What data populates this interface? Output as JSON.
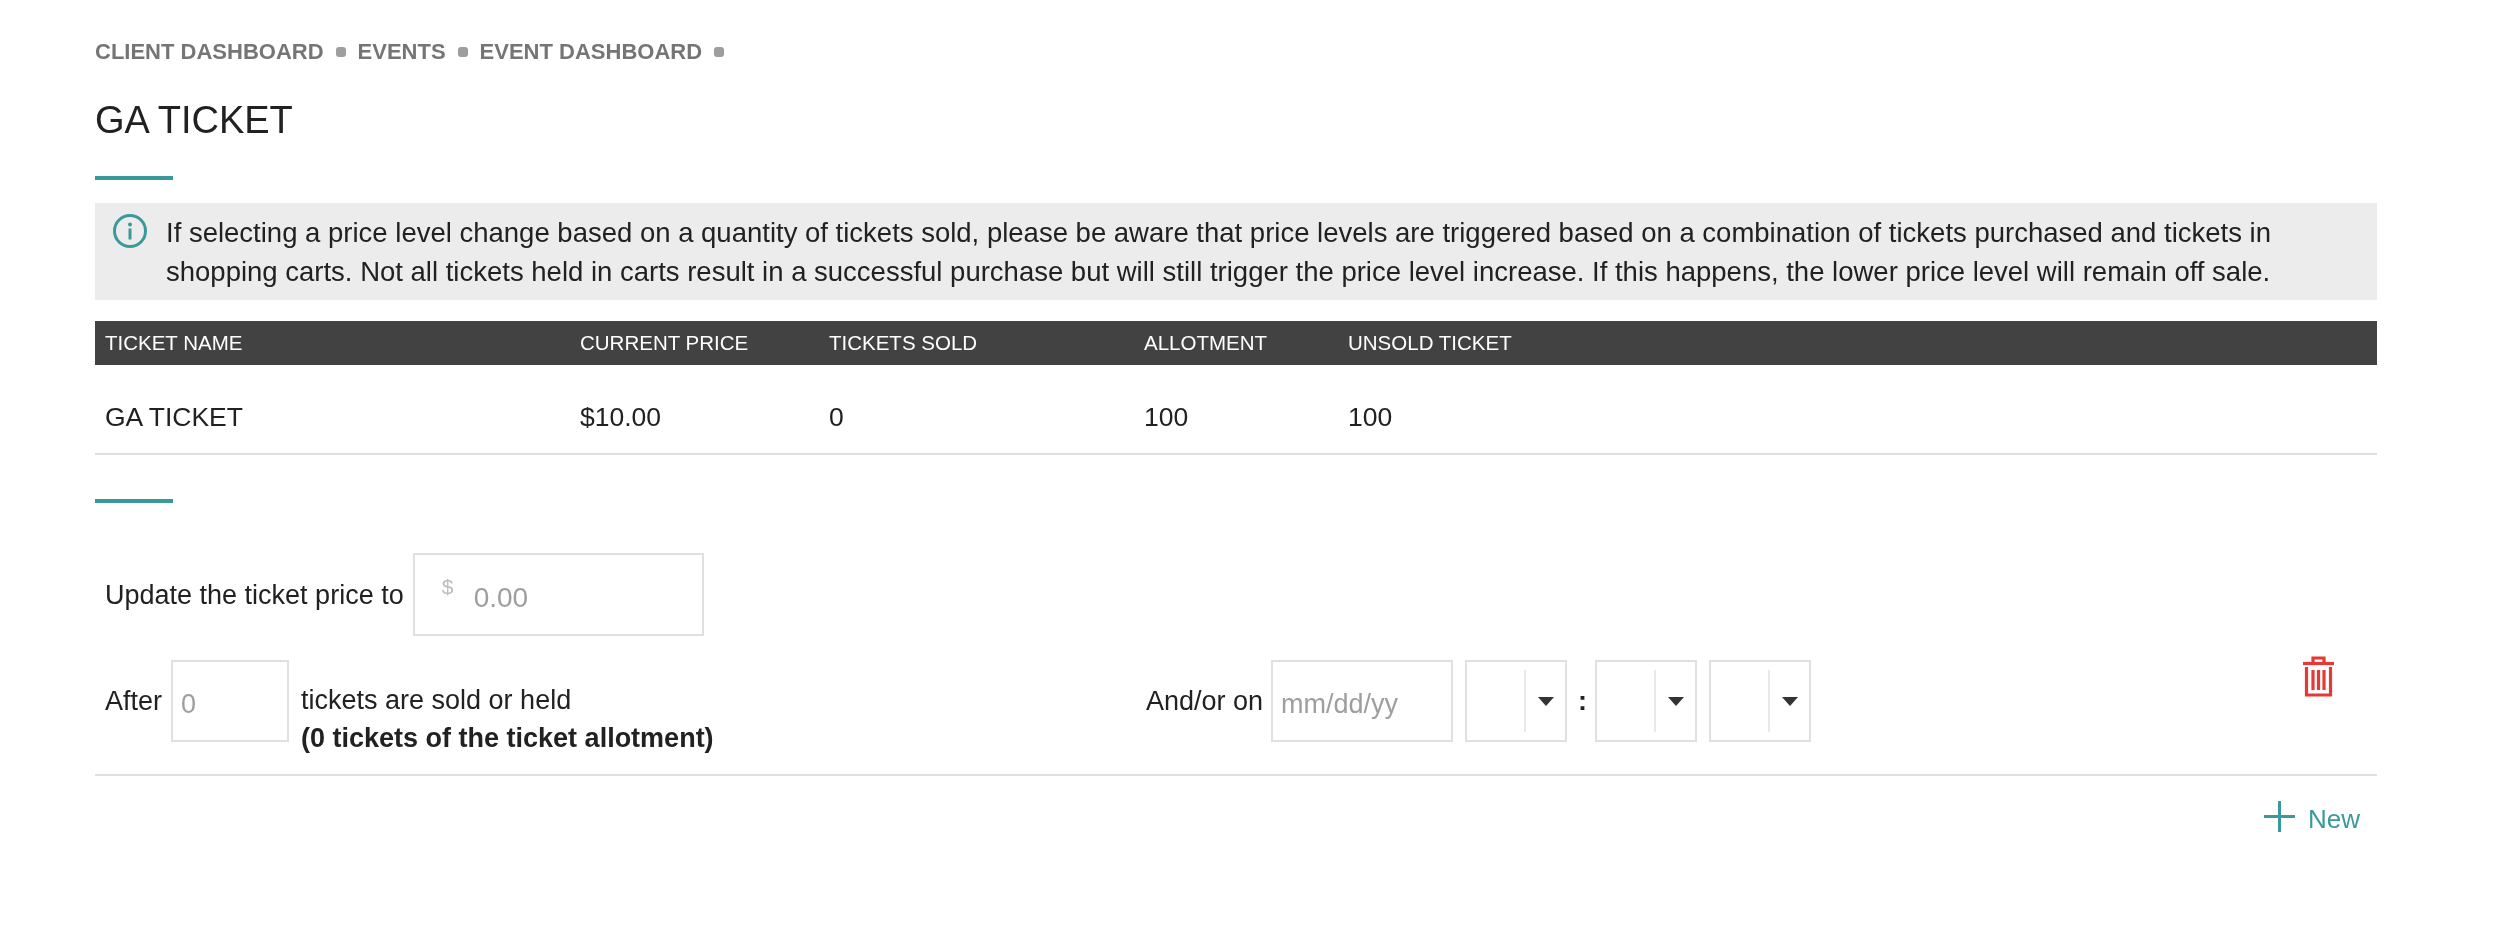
{
  "breadcrumb": [
    {
      "label": "CLIENT DASHBOARD"
    },
    {
      "label": "EVENTS"
    },
    {
      "label": "EVENT DASHBOARD"
    }
  ],
  "page_title": "GA TICKET",
  "notice": {
    "text": "If selecting a price level change based on a quantity of tickets sold, please be aware that price levels are triggered based on a combination of tickets purchased and tickets in shopping carts. Not all tickets held in carts result in a successful purchase but will still trigger the price level increase. If this happens, the lower price level will remain off sale."
  },
  "table": {
    "columns": [
      "TICKET NAME",
      "CURRENT PRICE",
      "TICKETS SOLD",
      "ALLOTMENT",
      "UNSOLD TICKET"
    ],
    "rows": [
      [
        "GA TICKET",
        "$10.00",
        "0",
        "100",
        "100"
      ]
    ]
  },
  "price_rule": {
    "price_label": "Update the ticket price to",
    "currency": "$",
    "price_placeholder": "0.00",
    "after_label": "After",
    "quantity_placeholder": "0",
    "sold_text": "tickets are sold or held",
    "allotment_note": "(0 tickets of the ticket allotment)",
    "date_label": "And/or on",
    "date_placeholder": "mm/dd/yy",
    "time_fields": [
      {
        "kind": "select"
      },
      {
        "kind": "separator",
        "text": ":"
      },
      {
        "kind": "select"
      },
      {
        "kind": "select"
      }
    ]
  },
  "new_button": {
    "label": "New"
  }
}
